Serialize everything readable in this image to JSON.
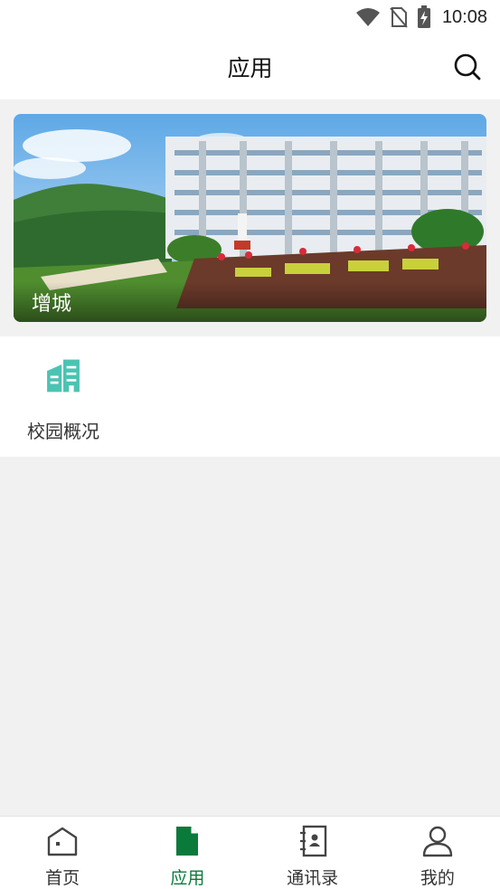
{
  "status_bar": {
    "time": "10:08",
    "icons": [
      "wifi-icon",
      "no-sim-icon",
      "battery-charging-icon"
    ]
  },
  "header": {
    "title": "应用",
    "search_icon": "search-icon"
  },
  "banner": {
    "caption": "增城"
  },
  "apps": [
    {
      "label": "校园概况",
      "icon": "building-icon",
      "color": "#4cc3b2"
    }
  ],
  "bottom_nav": {
    "items": [
      {
        "label": "首页",
        "icon": "home-icon",
        "active": false
      },
      {
        "label": "应用",
        "icon": "document-icon",
        "active": true
      },
      {
        "label": "通讯录",
        "icon": "contacts-book-icon",
        "active": false
      },
      {
        "label": "我的",
        "icon": "person-icon",
        "active": false
      }
    ]
  },
  "colors": {
    "accent": "#0a7a3b",
    "app_icon": "#4cc3b2",
    "background": "#f1f1f1"
  }
}
